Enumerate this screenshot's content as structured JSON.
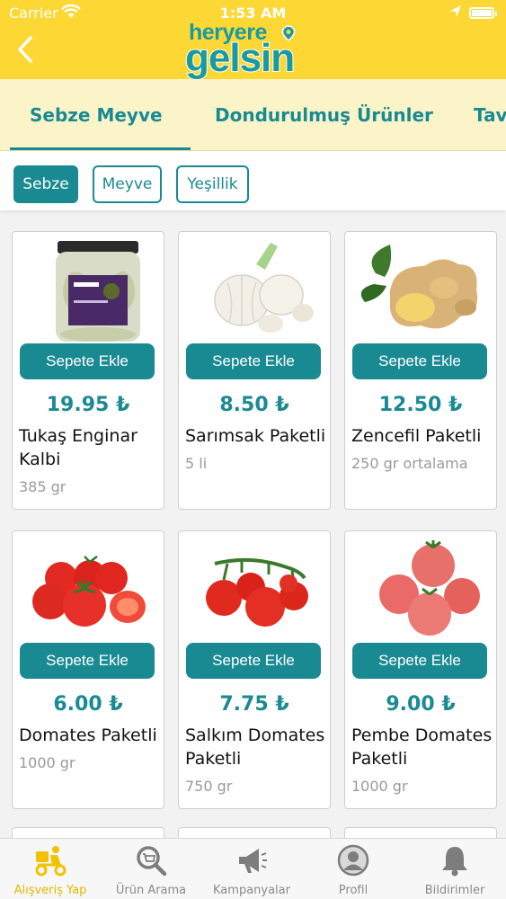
{
  "status_bar": {
    "carrier": "Carrier",
    "time": "1:53 AM",
    "battery_level": 0.9
  },
  "header": {
    "brand_top": "heryere",
    "brand_bottom": "gelsin",
    "brand_color": "#1a9aa0",
    "background": "#fdd834"
  },
  "category_tabs": [
    {
      "label": "Sebze Meyve",
      "selected": true
    },
    {
      "label": "Dondurulmuş Ürünler",
      "selected": false
    },
    {
      "label": "Tav",
      "selected": false
    }
  ],
  "sub_tabs": [
    {
      "label": "Sebze",
      "selected": true
    },
    {
      "label": "Meyve",
      "selected": false
    },
    {
      "label": "Yeşillik",
      "selected": false
    }
  ],
  "accent_color": "#1a8a92",
  "add_to_cart_label": "Sepete Ekle",
  "products": [
    {
      "price": "19.95 ₺",
      "name": "Tukaş Enginar Kalbi",
      "unit": "385 gr",
      "image": "artichoke-jar"
    },
    {
      "price": "8.50 ₺",
      "name": "Sarımsak Paketli",
      "unit": "5 li",
      "image": "garlic"
    },
    {
      "price": "12.50 ₺",
      "name": "Zencefil Paketli",
      "unit": "250 gr ortalama",
      "image": "ginger"
    },
    {
      "price": "6.00 ₺",
      "name": "Domates Paketli",
      "unit": "1000 gr",
      "image": "tomatoes"
    },
    {
      "price": "7.75 ₺",
      "name": "Salkım Domates Paketli",
      "unit": "750 gr",
      "image": "vine-tomatoes"
    },
    {
      "price": "9.00 ₺",
      "name": "Pembe Domates Paketli",
      "unit": "1000 gr",
      "image": "pink-tomatoes"
    }
  ],
  "bottom_nav": [
    {
      "label": "Alışveriş Yap",
      "icon": "scooter-icon",
      "active": true
    },
    {
      "label": "Ürün Arama",
      "icon": "search-cart-icon",
      "active": false
    },
    {
      "label": "Kampanyalar",
      "icon": "megaphone-icon",
      "active": false
    },
    {
      "label": "Profil",
      "icon": "profile-icon",
      "active": false
    },
    {
      "label": "Bildirimler",
      "icon": "bell-icon",
      "active": false
    }
  ]
}
